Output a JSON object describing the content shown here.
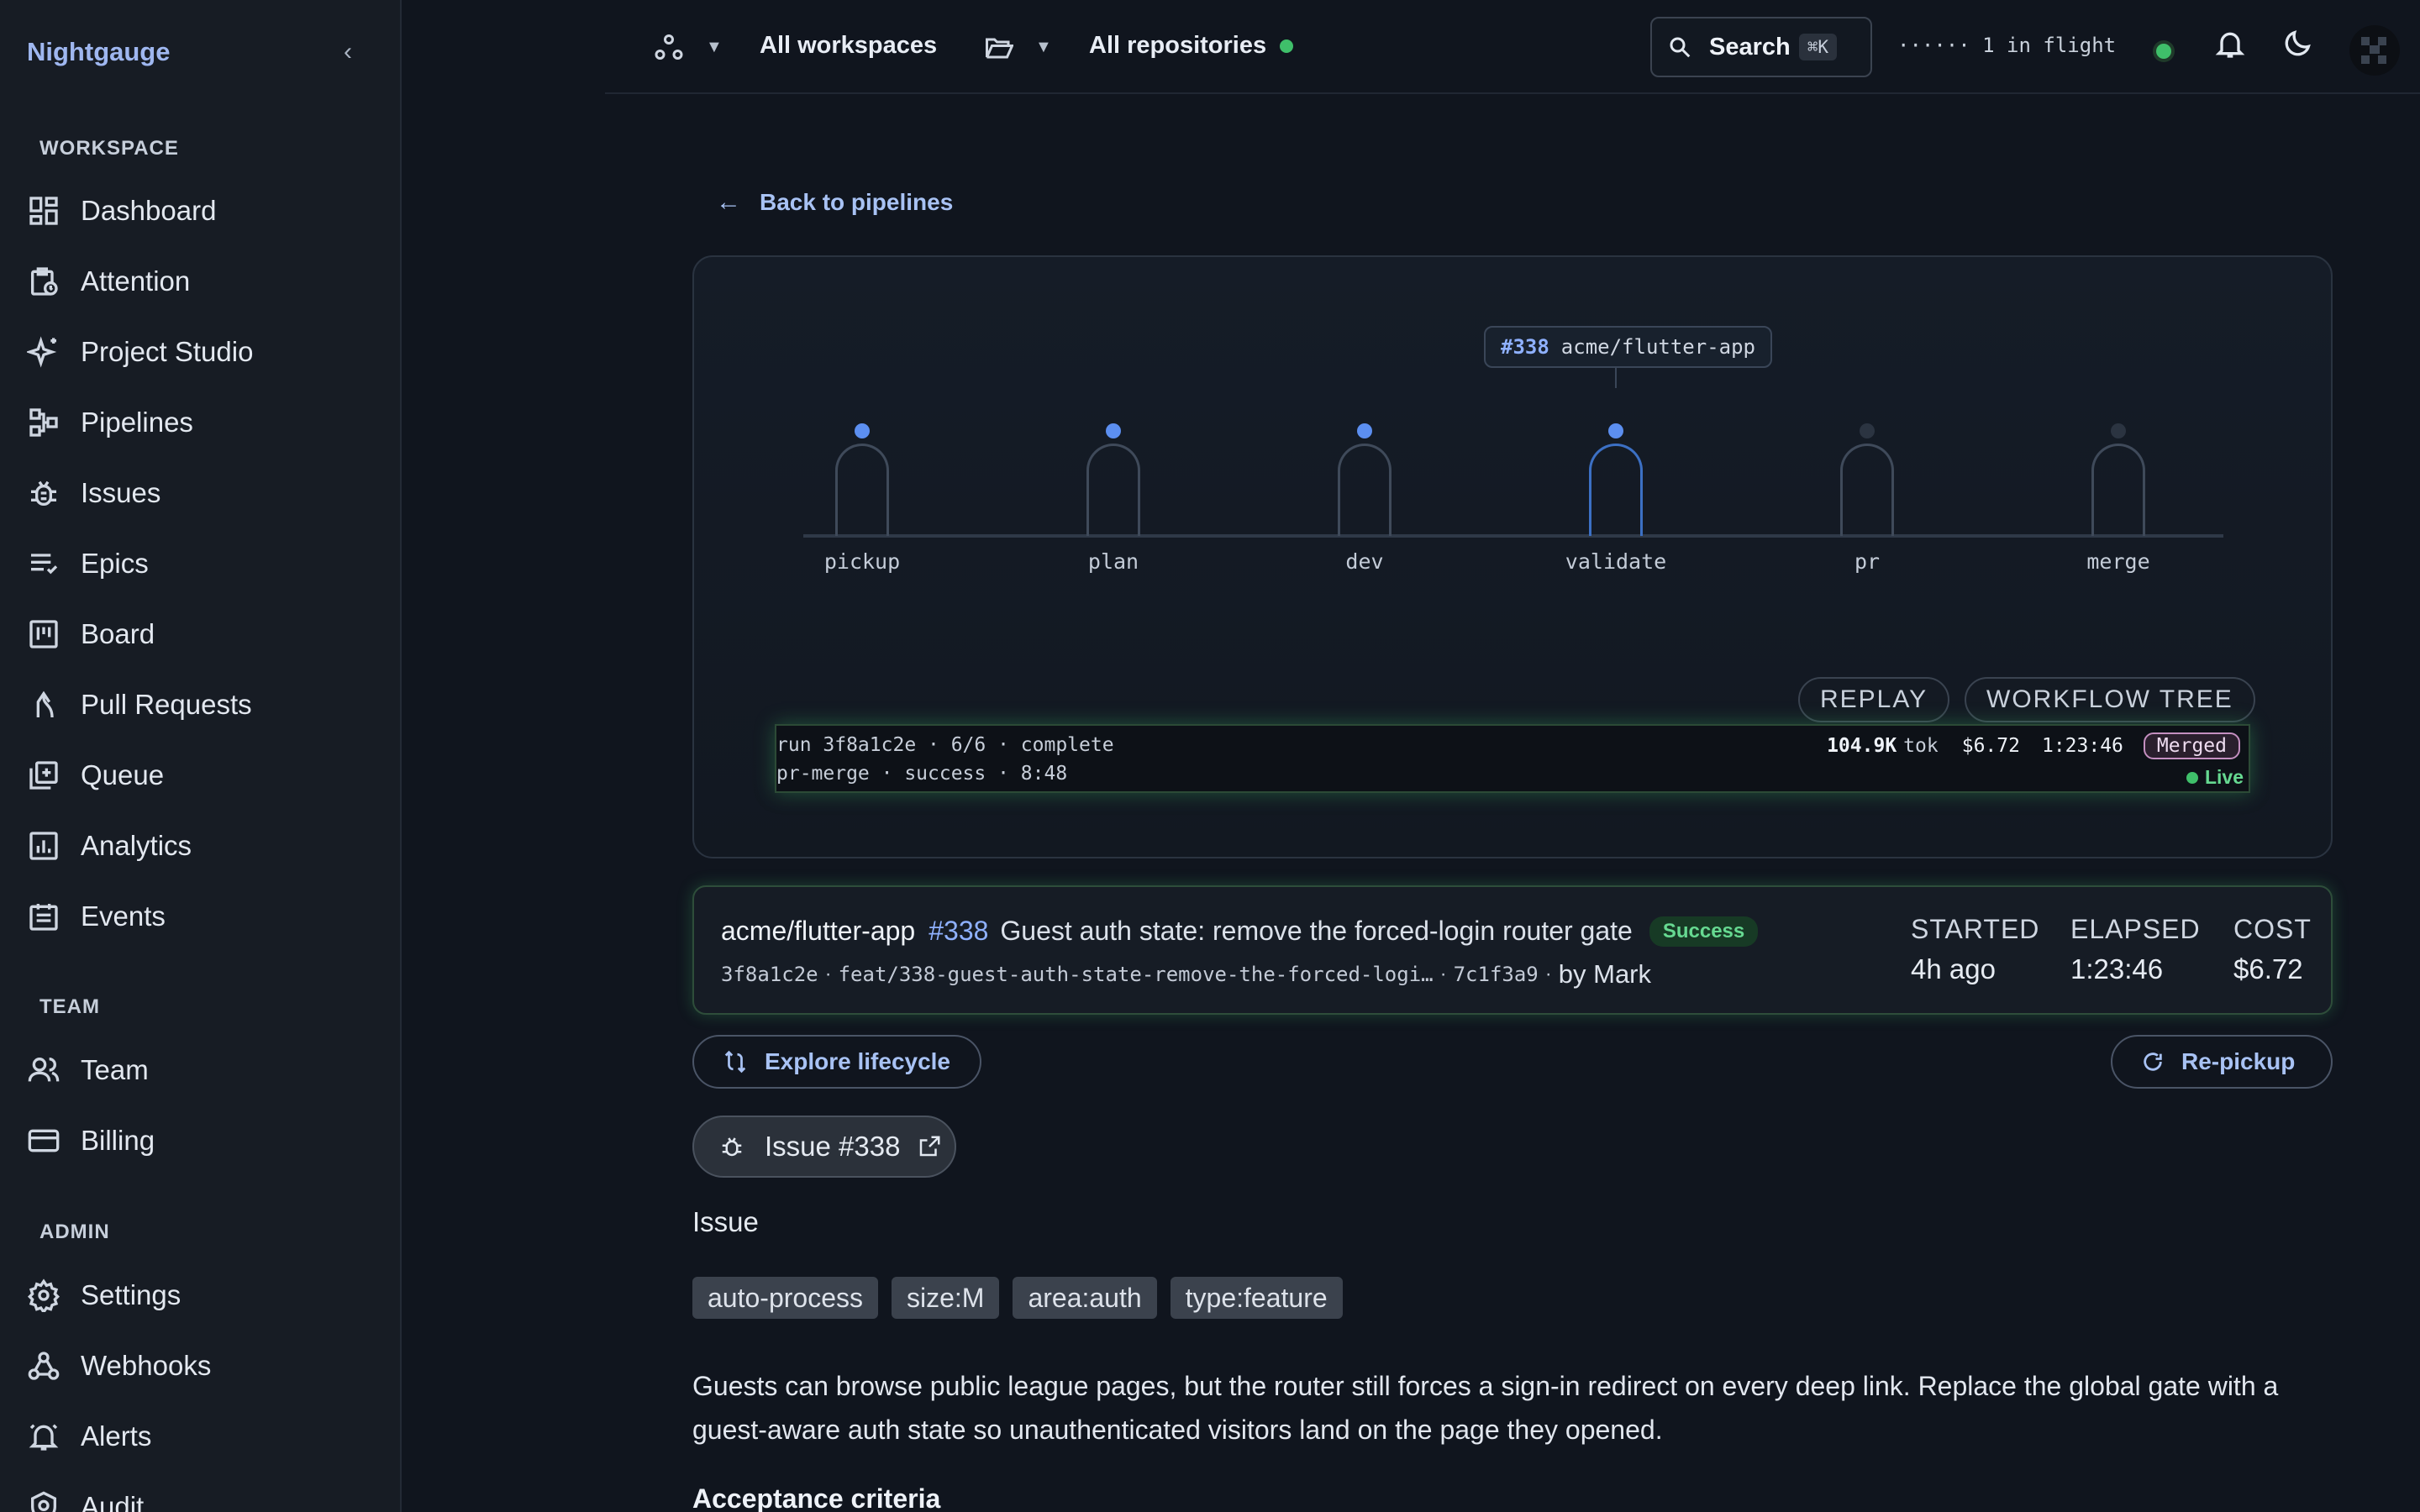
{
  "app": {
    "brand": "Nightgauge"
  },
  "sidebar": {
    "sections": [
      {
        "heading": "WORKSPACE",
        "items": [
          {
            "label": "Dashboard",
            "icon": "dashboard-icon"
          },
          {
            "label": "Attention",
            "icon": "attention-icon"
          },
          {
            "label": "Project Studio",
            "icon": "sparkles-icon"
          },
          {
            "label": "Pipelines",
            "icon": "pipelines-icon"
          },
          {
            "label": "Issues",
            "icon": "bug-icon"
          },
          {
            "label": "Epics",
            "icon": "list-icon"
          },
          {
            "label": "Board",
            "icon": "board-icon"
          },
          {
            "label": "Pull Requests",
            "icon": "merge-icon"
          },
          {
            "label": "Queue",
            "icon": "queue-icon"
          },
          {
            "label": "Analytics",
            "icon": "chart-icon"
          },
          {
            "label": "Events",
            "icon": "calendar-icon"
          }
        ]
      },
      {
        "heading": "TEAM",
        "items": [
          {
            "label": "Team",
            "icon": "users-icon"
          },
          {
            "label": "Billing",
            "icon": "card-icon"
          }
        ]
      },
      {
        "heading": "ADMIN",
        "items": [
          {
            "label": "Settings",
            "icon": "gear-icon"
          },
          {
            "label": "Webhooks",
            "icon": "webhook-icon"
          },
          {
            "label": "Alerts",
            "icon": "bell-alert-icon"
          },
          {
            "label": "Audit",
            "icon": "audit-icon"
          }
        ]
      }
    ]
  },
  "topbar": {
    "workspace": "All workspaces",
    "repository": "All repositories",
    "search_label": "Search",
    "search_shortcut": "⌘K",
    "inflight": "······ 1 in flight"
  },
  "main": {
    "back_label": "Back to pipelines",
    "run": {
      "number": "#338",
      "repo": "acme/flutter-app",
      "stages": [
        {
          "name": "pickup",
          "state": "done"
        },
        {
          "name": "plan",
          "state": "done"
        },
        {
          "name": "dev",
          "state": "done"
        },
        {
          "name": "validate",
          "state": "current"
        },
        {
          "name": "pr",
          "state": "pending"
        },
        {
          "name": "merge",
          "state": "pending"
        }
      ],
      "replay_label": "REPLAY",
      "tree_label": "WORKFLOW TREE",
      "console_line1": "run 3f8a1c2e · 6/6 · complete",
      "console_line2": "pr-merge · success · 8:48",
      "tokens": "104.9K",
      "tokens_unit": "tok",
      "cost": "$6.72",
      "duration": "1:23:46",
      "status_badge": "Merged",
      "live_label": "Live"
    },
    "summary": {
      "repo": "acme/flutter-app",
      "issue_ref": "#338",
      "title": "Guest auth state: remove the forced-login router gate",
      "status": "Success",
      "commit": "3f8a1c2e",
      "branch": "feat/338-guest-auth-state-remove-the-forced-logi…",
      "head": "7c1f3a9",
      "author": "by Mark",
      "started_label": "STARTED",
      "started_value": "4h ago",
      "elapsed_label": "ELAPSED",
      "elapsed_value": "1:23:46",
      "cost_label": "COST",
      "cost_value": "$6.72"
    },
    "explore_label": "Explore lifecycle",
    "repickup_label": "Re-pickup",
    "issue_chip": "Issue #338",
    "issue_heading": "Issue",
    "tags": [
      "auto-process",
      "size:M",
      "area:auth",
      "type:feature"
    ],
    "description": "Guests can browse public league pages, but the router still forces a sign-in redirect on every deep link. Replace the global gate with a guest-aware auth state so unauthenticated visitors land on the page they opened.",
    "acceptance_heading": "Acceptance criteria"
  },
  "colors": {
    "accent": "#a8c2f4",
    "success": "#3fbf6a",
    "merged": "#c48fc0"
  }
}
